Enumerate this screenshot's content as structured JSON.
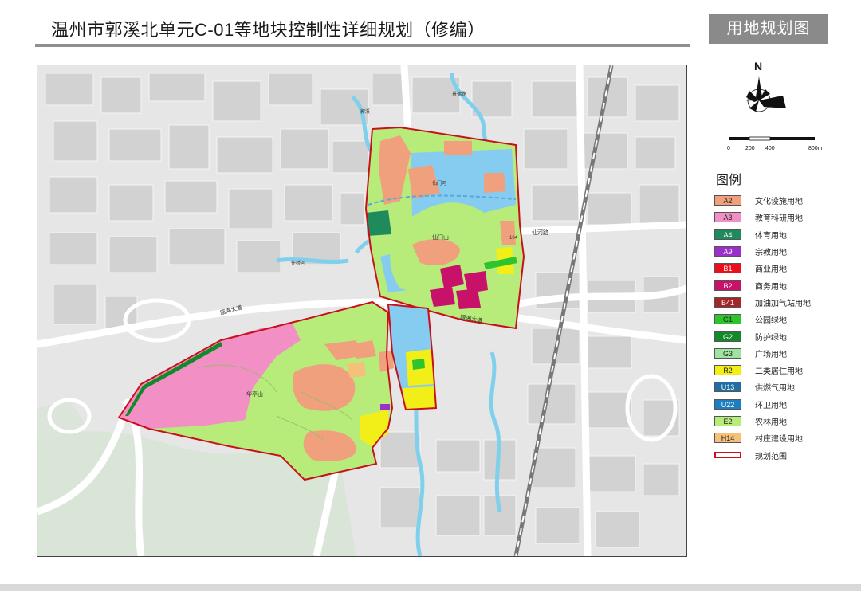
{
  "header": {
    "title": "温州市郭溪北单元C-01等地块控制性详细规划（修编）",
    "badge": "用地规划图"
  },
  "compass": {
    "north_label": "N"
  },
  "scale": {
    "ticks": [
      "0",
      "200",
      "400",
      "800m"
    ]
  },
  "legend": {
    "title": "图例",
    "items": [
      {
        "code": "A2",
        "label": "文化设施用地",
        "color": "#f0a07c"
      },
      {
        "code": "A3",
        "label": "教育科研用地",
        "color": "#f28fc4"
      },
      {
        "code": "A4",
        "label": "体育用地",
        "color": "#1f8a5b"
      },
      {
        "code": "A9",
        "label": "宗教用地",
        "color": "#9b2fc9"
      },
      {
        "code": "B1",
        "label": "商业用地",
        "color": "#e8101a"
      },
      {
        "code": "B2",
        "label": "商务用地",
        "color": "#c8126a"
      },
      {
        "code": "B41",
        "label": "加油加气站用地",
        "color": "#a3262b"
      },
      {
        "code": "G1",
        "label": "公园绿地",
        "color": "#2ec42e"
      },
      {
        "code": "G2",
        "label": "防护绿地",
        "color": "#138a2a"
      },
      {
        "code": "G3",
        "label": "广场用地",
        "color": "#9fe3a0"
      },
      {
        "code": "R2",
        "label": "二类居住用地",
        "color": "#f2ef18"
      },
      {
        "code": "U13",
        "label": "供燃气用地",
        "color": "#1f6fa3"
      },
      {
        "code": "U22",
        "label": "环卫用地",
        "color": "#1d7fbf"
      },
      {
        "code": "E2",
        "label": "农林用地",
        "color": "#b7ec7a"
      },
      {
        "code": "H14",
        "label": "村庄建设用地",
        "color": "#f5c07a"
      },
      {
        "code": "",
        "label": "规划范围",
        "color": "#c8101a"
      }
    ]
  },
  "map": {
    "place_labels": {
      "huatingshan": "华亭山",
      "xianmenshan": "仙门山",
      "xianmenhe": "仙门河",
      "renqiaohe": "任桥河",
      "guoxi": "郭溪"
    },
    "road_labels": {
      "ouhai_road_west": "瓯海大道",
      "ouhai_road_east": "瓯海大道",
      "xianhe_road": "仙河路",
      "jingye_road": "景德路",
      "road_104": "104"
    }
  }
}
